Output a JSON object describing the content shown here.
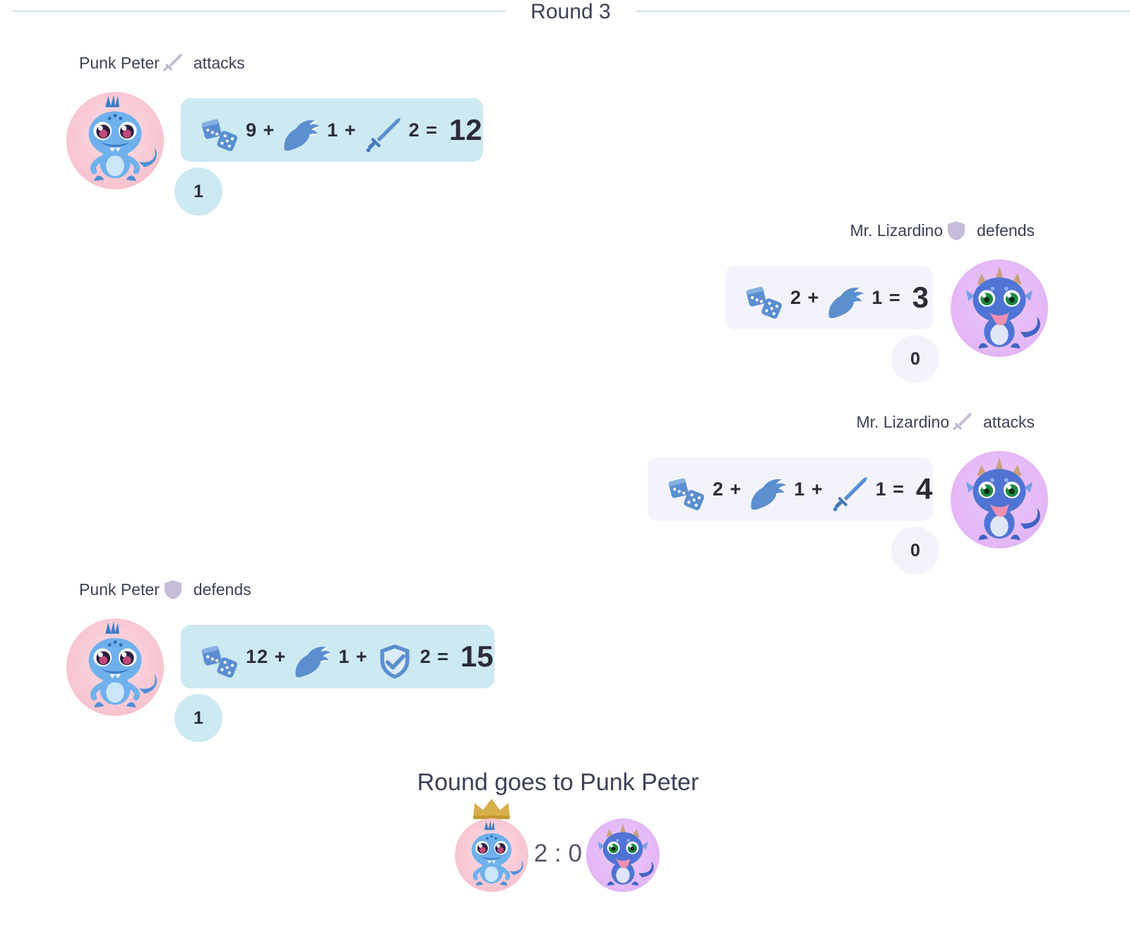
{
  "round": {
    "title": "Round 3"
  },
  "players": {
    "peter": {
      "name": "Punk Peter"
    },
    "lizardino": {
      "name": "Mr. Lizardino"
    }
  },
  "turns": [
    {
      "player_name": "Punk Peter",
      "action": "attacks",
      "role_icon": "sword-icon",
      "terms": [
        {
          "icon": "dice-icon",
          "text": "9 +"
        },
        {
          "icon": "claw-icon",
          "text": "1 +"
        },
        {
          "icon": "sword-icon",
          "text": "2 ="
        }
      ],
      "total": "12",
      "score": "1"
    },
    {
      "player_name": "Mr. Lizardino",
      "action": "defends",
      "role_icon": "shield-icon",
      "terms": [
        {
          "icon": "dice-icon",
          "text": "2 +"
        },
        {
          "icon": "claw-icon",
          "text": "1 ="
        }
      ],
      "total": "3",
      "score": "0"
    },
    {
      "player_name": "Mr. Lizardino",
      "action": "attacks",
      "role_icon": "sword-icon",
      "terms": [
        {
          "icon": "dice-icon",
          "text": "2 +"
        },
        {
          "icon": "claw-icon",
          "text": "1 +"
        },
        {
          "icon": "sword-icon",
          "text": "1 ="
        }
      ],
      "total": "4",
      "score": "0"
    },
    {
      "player_name": "Punk Peter",
      "action": "defends",
      "role_icon": "shield-icon",
      "terms": [
        {
          "icon": "dice-icon",
          "text": "12 +"
        },
        {
          "icon": "claw-icon",
          "text": "1 +"
        },
        {
          "icon": "shield-check-icon",
          "text": "2 ="
        }
      ],
      "total": "15",
      "score": "1"
    }
  ],
  "result": {
    "text": "Round goes to Punk Peter",
    "score": "2 : 0",
    "winner_icon": "crown-icon"
  },
  "colors": {
    "peter_avatar_bg": "#f7c4cf",
    "lizardino_avatar_bg": "#e3b6f6",
    "winner_box": "#cde9f2",
    "loser_box": "#f3f4fb",
    "icon_blue": "#5b8fd0",
    "role_icon": "#c6bcd8",
    "crown": "#d8b04a"
  }
}
